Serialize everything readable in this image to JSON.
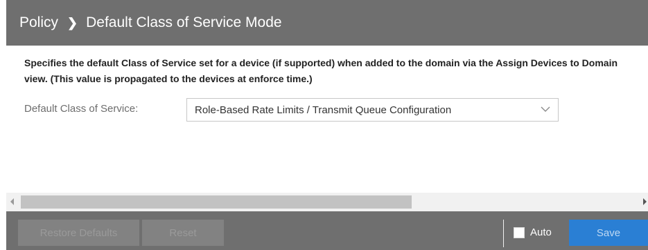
{
  "header": {
    "breadcrumb_root": "Policy",
    "separator_glyph": "❯",
    "page_title": "Default Class of Service Mode"
  },
  "main": {
    "description": "Specifies the default Class of Service set for a device (if supported) when added to the domain via the Assign Devices to Domain view. (This value is propagated to the devices at enforce time.)",
    "field_label": "Default Class of Service:",
    "select_value": "Role-Based Rate Limits / Transmit Queue Configuration"
  },
  "footer": {
    "restore_label": "Restore Defaults",
    "reset_label": "Reset",
    "auto_label": "Auto",
    "auto_checked": false,
    "save_label": "Save"
  },
  "colors": {
    "header_bg": "#6f6f6f",
    "save_button": "#2a7fd4",
    "disabled_button": "#828282"
  },
  "icons": {
    "separator": "chevron-right-icon",
    "select_arrow": "chevron-down-icon",
    "scroll_left": "scroll-left-arrow-icon",
    "scroll_right": "scroll-right-arrow-icon"
  }
}
